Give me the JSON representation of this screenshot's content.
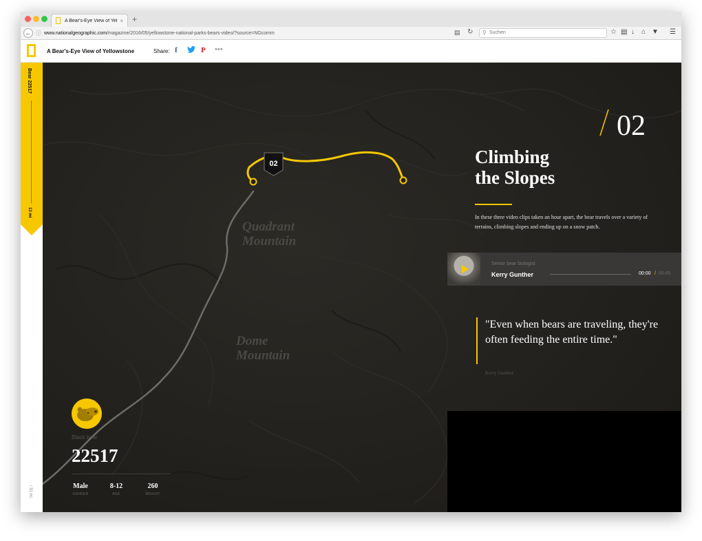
{
  "browser": {
    "tab_title": "A Bear's-Eye View of Yello...",
    "tab_close": "×",
    "new_tab": "+",
    "url_domain": "www.nationalgeographic.com",
    "url_path": "/magazine/2016/05/yellowstone-national-parks-bears-video/?source=NGcomm",
    "search_placeholder": "Suchen"
  },
  "header": {
    "site_title": "A Bear's-Eye View of Yellowstone",
    "share_label": "Share:",
    "facebook": "f",
    "twitter": "🐦",
    "pinterest": "P",
    "more": "•••"
  },
  "sidebar": {
    "bear_label": "Bear 22517",
    "distance": "13 mi",
    "total_distance": "/ 51 mi",
    "progress_fraction": 0.36
  },
  "map": {
    "labels": [
      {
        "line1": "Quadrant",
        "line2": "Mountain"
      },
      {
        "line1": "Dome",
        "line2": "Mountain"
      }
    ],
    "badge": "02",
    "route_color": "#f7c800"
  },
  "story": {
    "chapter_number": "02",
    "title_line1": "Climbing",
    "title_line2": "the Slopes",
    "intro": "In these three video clips taken an hour apart, the bear travels over a variety of terrains, climbing slopes and ending up on a snow patch.",
    "audio": {
      "role": "Senior bear biologist",
      "name": "Kerry Gunther",
      "current_time": "00:00",
      "separator": "/",
      "total_time": "00:45"
    },
    "quote": "\"Even when bears are traveling, they're often feeding the entire time.\"",
    "quote_author": "Kerry Gunther"
  },
  "bear": {
    "species": "Black bear",
    "number": "22517",
    "stats": [
      {
        "value": "Male",
        "label": "GENDER"
      },
      {
        "value": "8-12",
        "label": "AGE"
      },
      {
        "value": "260",
        "label": "WEIGHT"
      }
    ]
  },
  "colors": {
    "accent": "#f7c800",
    "map_bg": "#262420"
  }
}
